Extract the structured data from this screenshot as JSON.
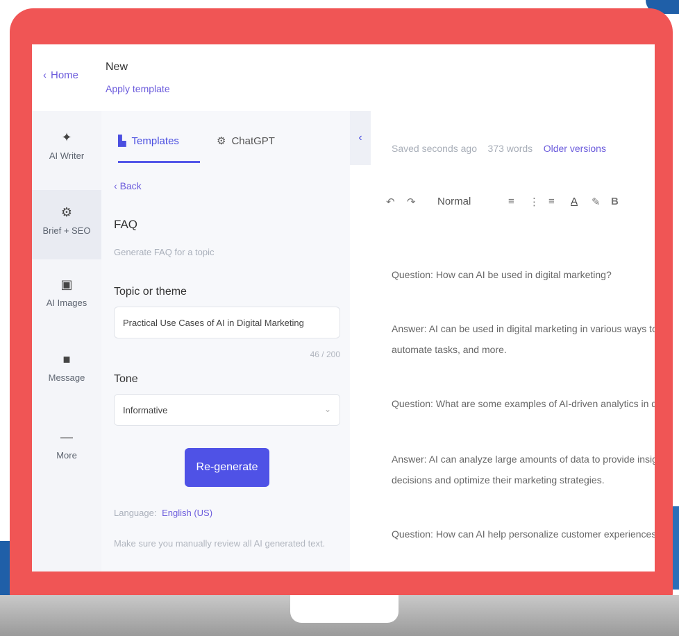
{
  "topbar": {
    "home_label": "Home",
    "doc_title": "New",
    "apply_template": "Apply template"
  },
  "rail": {
    "items": [
      {
        "icon": "sparkle-icon",
        "glyph": "✦",
        "label": "AI Writer"
      },
      {
        "icon": "gear-icon",
        "glyph": "⚙",
        "label": "Brief + SEO"
      },
      {
        "icon": "image-icon",
        "glyph": "▣",
        "label": "AI Images"
      },
      {
        "icon": "message-icon",
        "glyph": "■",
        "label": "Message"
      },
      {
        "icon": "more-icon",
        "glyph": "—",
        "label": "More"
      }
    ]
  },
  "panel": {
    "tabs": [
      {
        "label": "Templates",
        "icon": "document-icon",
        "active": true
      },
      {
        "label": "ChatGPT",
        "icon": "chatgpt-icon",
        "active": false
      }
    ],
    "back_label": "Back",
    "template_title": "FAQ",
    "template_desc": "Generate FAQ for a topic",
    "topic_label": "Topic or theme",
    "topic_value": "Practical Use Cases of AI in Digital Marketing",
    "topic_counter": "46 / 200",
    "tone_label": "Tone",
    "tone_value": "Informative",
    "regenerate_label": "Re-generate",
    "language_label": "Language:",
    "language_value": "English (US)",
    "disclaimer": "Make sure you manually review all AI generated text."
  },
  "editor": {
    "saved_status": "Saved seconds ago",
    "word_count": "373 words",
    "older_versions": "Older versions",
    "style_select": "Normal",
    "paragraphs": [
      "Question: How can AI be used in digital marketing?",
      "Answer: AI can be used in digital marketing in various ways to analyze data, personalize content,",
      "automate tasks, and more.",
      "Question: What are some examples of AI-driven analytics in digital marketing?",
      "Answer: AI can analyze large amounts of data to provide insights that help marketers make data-driven",
      "decisions and optimize their marketing strategies.",
      "Question: How can AI help personalize customer experiences?"
    ]
  },
  "colors": {
    "laptop_frame": "#f05555",
    "accent": "#4f52e6",
    "link": "#6b5bdc"
  }
}
